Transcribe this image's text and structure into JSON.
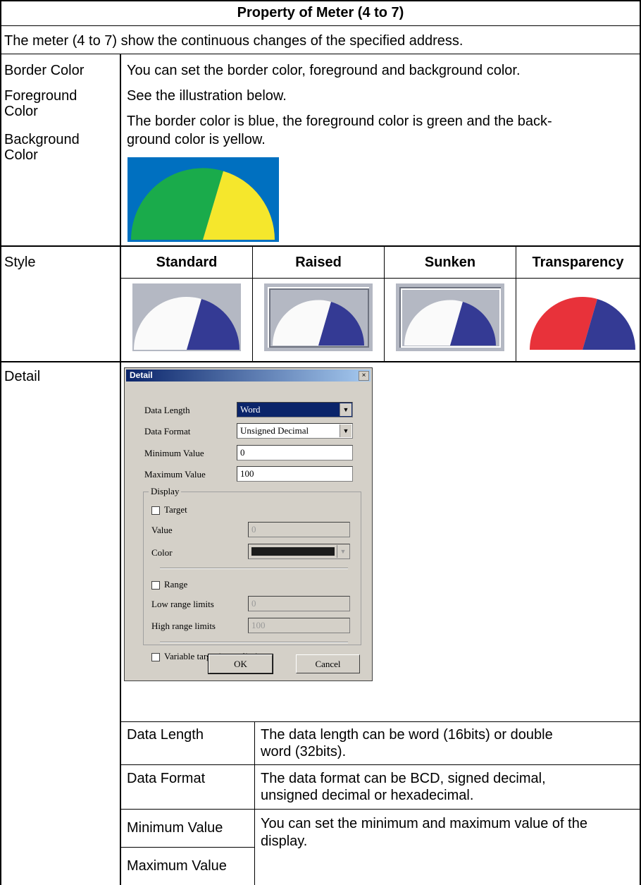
{
  "header": {
    "title": "Property of Meter (4 to 7)"
  },
  "intro": "The meter (4 to 7) show the continuous changes of the specified address.",
  "colors_row": {
    "labels": [
      "Border Color",
      "Foreground",
      "Color",
      "Background",
      "Color"
    ],
    "lines": [
      "You can set the border color, foreground and background color.",
      "See the illustration below.",
      "The border color is blue, the foreground color is green and the back-",
      "ground color is yellow."
    ],
    "illustration_colors": {
      "border": "#0070c0",
      "foreground": "#1aab4b",
      "background": "#f5e72c"
    }
  },
  "style_row": {
    "label": "Style",
    "columns": [
      "Standard",
      "Raised",
      "Sunken",
      "Transparency"
    ],
    "meter_colors": {
      "frame": "#b4b8c3",
      "white": "#fafafa",
      "blue": "#343a94",
      "red": "#e8323a"
    }
  },
  "detail_row": {
    "label": "Detail",
    "dialog": {
      "title": "Detail",
      "data_length_label": "Data Length",
      "data_length_value": "Word",
      "data_format_label": "Data Format",
      "data_format_value": "Unsigned Decimal",
      "min_label": "Minimum Value",
      "min_value": "0",
      "max_label": "Maximum Value",
      "max_value": "100",
      "display_group": "Display",
      "target_label": "Target",
      "value_label": "Value",
      "value_value": "0",
      "color_label": "Color",
      "range_label": "Range",
      "low_label": "Low range limits",
      "low_value": "0",
      "high_label": "High range limits",
      "high_value": "100",
      "variable_label": "Variable target/range limits",
      "ok_label": "OK",
      "cancel_label": "Cancel"
    },
    "subtable": [
      {
        "name": "Data Length",
        "desc": [
          "The data length can be word (16bits) or double",
          "word (32bits)."
        ]
      },
      {
        "name": "Data Format",
        "desc": [
          "The data format can be BCD, signed decimal,",
          "unsigned decimal or hexadecimal."
        ]
      },
      {
        "name": "Minimum Value",
        "desc": [
          "You can set the minimum and maximum value of the",
          "display."
        ]
      },
      {
        "name": "Maximum Value",
        "desc": []
      }
    ]
  }
}
